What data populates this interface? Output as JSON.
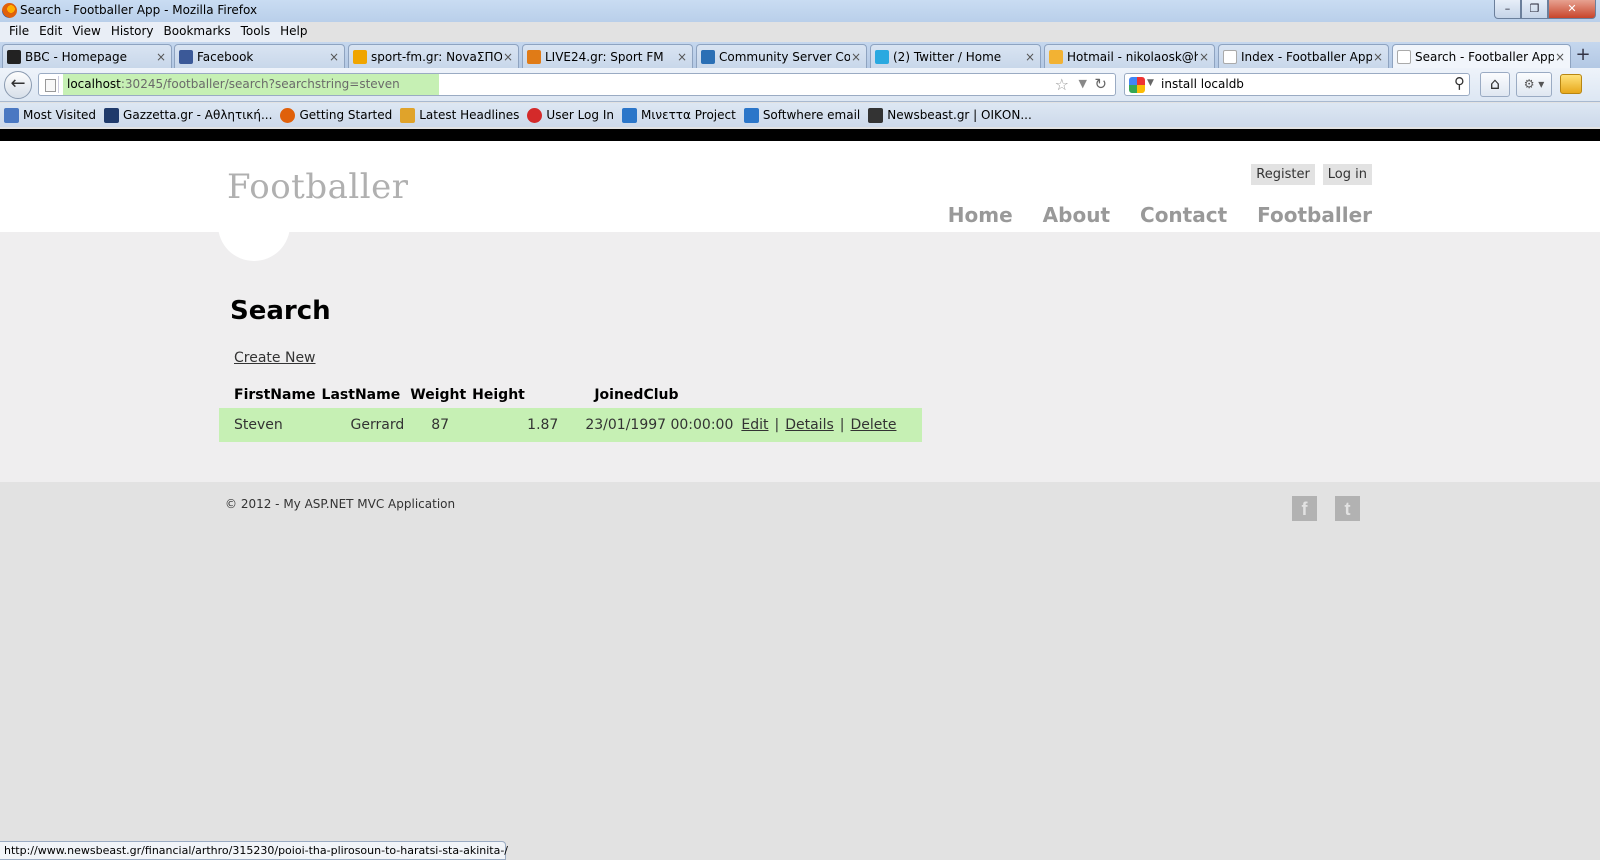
{
  "window": {
    "title": "Search - Footballer App - Mozilla Firefox"
  },
  "menu": [
    "File",
    "Edit",
    "View",
    "History",
    "Bookmarks",
    "Tools",
    "Help"
  ],
  "tabs": [
    {
      "label": "BBC - Homepage",
      "icon": "bbc-icon",
      "color": "#222222"
    },
    {
      "label": "Facebook",
      "icon": "facebook-icon",
      "color": "#3b5998"
    },
    {
      "label": "sport-fm.gr: NovaΣΠΟ...",
      "icon": "sportfm-icon",
      "color": "#f0a500"
    },
    {
      "label": "LIVE24.gr: Sport FM",
      "icon": "rss-icon",
      "color": "#e07b17"
    },
    {
      "label": "Community Server Co...",
      "icon": "community-server-icon",
      "color": "#2a6fb5"
    },
    {
      "label": "(2) Twitter / Home",
      "icon": "twitter-icon",
      "color": "#2aa9e0"
    },
    {
      "label": "Hotmail - nikolaosk@h...",
      "icon": "hotmail-icon",
      "color": "#f2b233"
    },
    {
      "label": "Index - Footballer App",
      "icon": "page-icon",
      "color": "#dddddd"
    },
    {
      "label": "Search - Footballer App",
      "icon": "page-icon",
      "color": "#dddddd"
    }
  ],
  "address": {
    "host": "localhost",
    "path": ":30245/footballer/search?searchstring=steven"
  },
  "search_box": {
    "value": "install localdb"
  },
  "bookmarks": [
    {
      "label": "Most Visited",
      "icon": "most-visited-icon",
      "color": "#4a78c2"
    },
    {
      "label": "Gazzetta.gr - Αθλητική...",
      "icon": "gazzetta-icon",
      "color": "#1f3a6b"
    },
    {
      "label": "Getting Started",
      "icon": "firefox-icon",
      "color": "#e0600a"
    },
    {
      "label": "Latest Headlines",
      "icon": "rss-icon",
      "color": "#e0a32a"
    },
    {
      "label": "User Log In",
      "icon": "flower-icon",
      "color": "#d42a2a"
    },
    {
      "label": "Μινεττα Project",
      "icon": "project-icon",
      "color": "#2b76c9"
    },
    {
      "label": "Softwhere email",
      "icon": "email-icon",
      "color": "#2b76c9"
    },
    {
      "label": "Newsbeast.gr | ΟΙΚΟΝ...",
      "icon": "newsbeast-icon",
      "color": "#333333"
    }
  ],
  "site": {
    "title": "Footballer",
    "login_links": [
      "Register",
      "Log in"
    ],
    "nav": [
      "Home",
      "About",
      "Contact",
      "Footballer"
    ]
  },
  "content": {
    "page_title": "Search",
    "create_link": "Create New",
    "table": {
      "headers": [
        "FirstName",
        "LastName",
        "Weight",
        "Height",
        "JoinedClub"
      ],
      "rows": [
        {
          "first": "Steven",
          "last": "Gerrard",
          "weight": "87",
          "height": "1.87",
          "joined": "23/01/1997 00:00:00",
          "actions": [
            "Edit",
            "Details",
            "Delete"
          ]
        }
      ],
      "row_highlight": "#c6f0b4"
    }
  },
  "footer": {
    "copyright": "© 2012 - My ASP.NET MVC Application",
    "social": [
      {
        "name": "facebook-icon",
        "glyph": "f"
      },
      {
        "name": "twitter-icon",
        "glyph": "t"
      }
    ]
  },
  "status": {
    "text": "http://www.newsbeast.gr/financial/arthro/315230/poioi-tha-plirosoun-to-haratsi-sta-akinita-/"
  }
}
